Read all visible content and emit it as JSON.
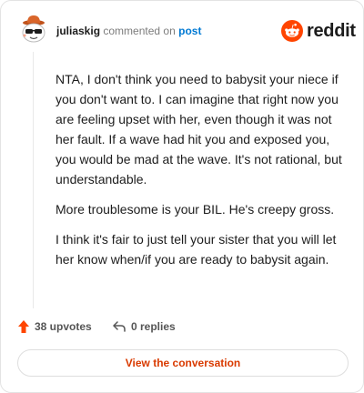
{
  "header": {
    "username": "juliaskig",
    "action_text": "commented on",
    "post_link": "post",
    "brand": "reddit"
  },
  "comment": {
    "paragraphs": [
      "NTA, I don't think you need to babysit your niece if you don't want to. I can imagine that right now you are feeling upset with her, even though it was not her fault. If a wave had hit you and exposed you, you would be mad at the wave. It's not rational, but understandable.",
      "More troublesome is your BIL. He's creepy gross.",
      "I think it's fair to just tell your sister that you will let her know when/if you are ready to babysit again."
    ]
  },
  "actions": {
    "upvotes": "38 upvotes",
    "replies": "0 replies"
  },
  "cta": {
    "label": "View the conversation"
  },
  "colors": {
    "accent": "#ff4500",
    "link": "#0079d3",
    "cta_text": "#d93a00"
  },
  "icons": [
    "avatar",
    "reddit-logo-icon",
    "upvote-arrow-icon",
    "reply-arrow-icon"
  ]
}
